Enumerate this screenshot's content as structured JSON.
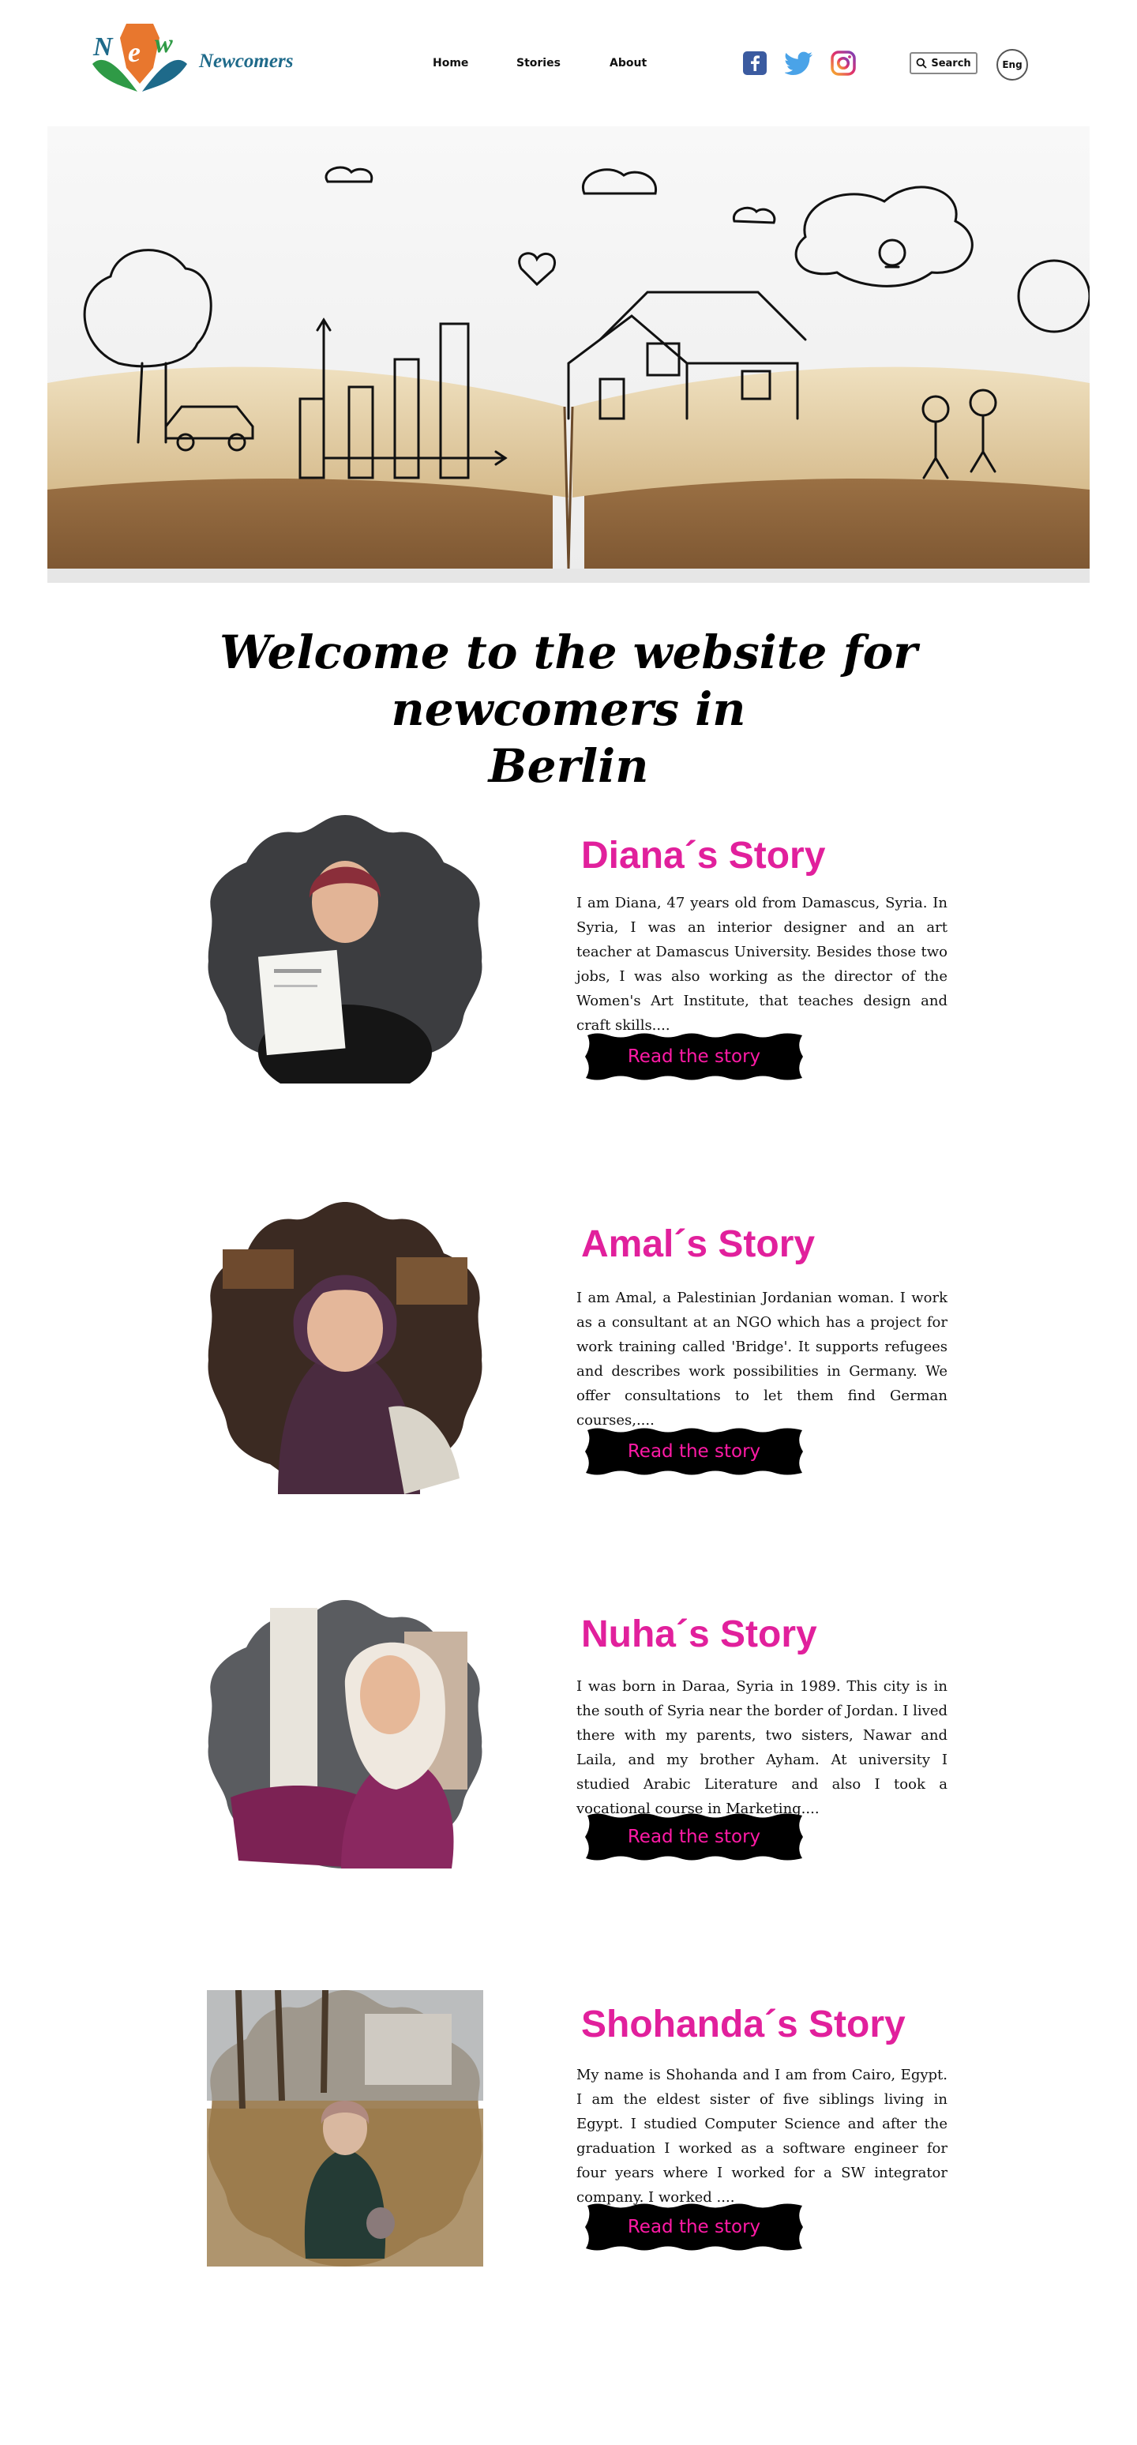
{
  "colors": {
    "accent": "#e1209c",
    "button_bg": "#000000",
    "button_text": "#ff1aa6",
    "logo_blue": "#1e6a8a",
    "logo_orange": "#e8772e",
    "logo_green": "#2f9a46"
  },
  "header": {
    "logo_mark": "NEW",
    "logo_text": "Newcomers",
    "nav": {
      "home": "Home",
      "stories": "Stories",
      "about": "About"
    },
    "social_icons": [
      "facebook-icon",
      "twitter-icon",
      "instagram-icon"
    ],
    "search_label": "Search",
    "language": "Eng"
  },
  "welcome": {
    "line1": "Welcome to the website for newcomers in",
    "line2": "Berlin"
  },
  "stories": [
    {
      "title": "Diana´s Story",
      "text": "I am Diana, 47 years old from Damascus, Syria. In Syria, I was an interior designer and an art teacher at Damascus University. Besides those two jobs, I was also working as the director of the Women's Art Institute, that teaches design and craft skills....",
      "button": "Read the story"
    },
    {
      "title": "Amal´s Story",
      "text": "I am Amal, a Palestinian Jordanian woman. I work as a consultant at an NGO which has a project for work training called 'Bridge'. It supports refugees and describes work possibilities in Germany. We offer consultations to let them find German courses,....",
      "button": "Read the story"
    },
    {
      "title": "Nuha´s Story",
      "text": "I was born in Daraa, Syria in 1989. This city is in the south of Syria near the border of Jordan. I lived there with my parents, two sisters, Nawar and Laila, and my brother Ayham. At university I studied Arabic Literature and also I took a vocational course in Marketing....",
      "button": "Read the story"
    },
    {
      "title": "Shohanda´s Story",
      "text": "My name is Shohanda and I am from Cairo, Egypt. I am the eldest sister of five siblings living in Egypt. I studied Computer Science and after the graduation I worked as a software engineer for four years where I worked for a SW integrator company. I worked ....",
      "button": "Read the story"
    }
  ]
}
